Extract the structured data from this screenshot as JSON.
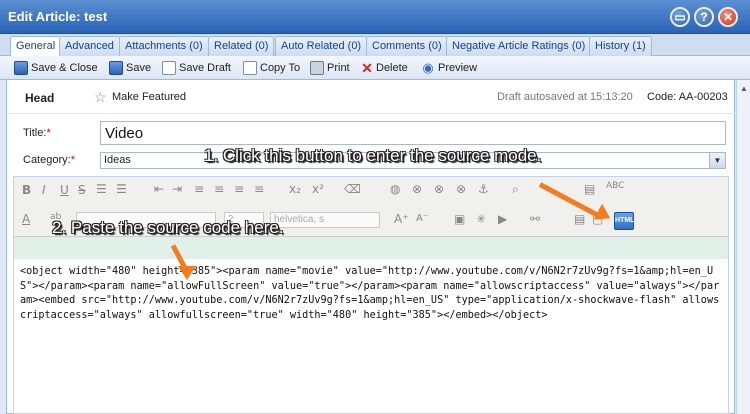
{
  "window": {
    "title": "Edit Article: test",
    "minimize_label": "▭",
    "help_label": "?",
    "close_label": "✕"
  },
  "tabs": [
    {
      "label": "General"
    },
    {
      "label": "Advanced"
    },
    {
      "label": "Attachments (0)"
    },
    {
      "label": "Related (0)"
    },
    {
      "label": "Auto Related (0)"
    },
    {
      "label": "Comments (0)"
    },
    {
      "label": "Negative Article Ratings (0)"
    },
    {
      "label": "History (1)"
    }
  ],
  "toolbar": {
    "save_close": "Save & Close",
    "save": "Save",
    "save_draft": "Save Draft",
    "copy_to": "Copy To",
    "print": "Print",
    "delete": "Delete",
    "preview": "Preview"
  },
  "head": {
    "label": "Head",
    "make_featured": "Make Featured",
    "autosave": "Draft autosaved at 15:13:20",
    "code": "Code: AA-00203"
  },
  "form": {
    "title_label": "Title:",
    "title_value": "Video",
    "category_label": "Category:",
    "category_value": "Ideas",
    "required_mark": "*"
  },
  "editor": {
    "font_combo": "helvetica, s",
    "size_combo": "2",
    "html_button": "HTML",
    "source_code": "<object width=\"480\" height=\"385\"><param name=\"movie\" value=\"http://www.youtube.com/v/N6N2r7zUv9g?fs=1&amp;hl=en_US\"></param><param name=\"allowFullScreen\" value=\"true\"></param><param name=\"allowscriptaccess\" value=\"always\"></param><embed src=\"http://www.youtube.com/v/N6N2r7zUv9g?fs=1&amp;hl=en_US\" type=\"application/x-shockwave-flash\" allowscriptaccess=\"always\" allowfullscreen=\"true\" width=\"480\" height=\"385\"></embed></object>"
  },
  "annotations": {
    "step1": "1. Click this button to enter the source mode.",
    "step2": "2. Paste the source code here.",
    "arrow_color": "#f47b20"
  }
}
